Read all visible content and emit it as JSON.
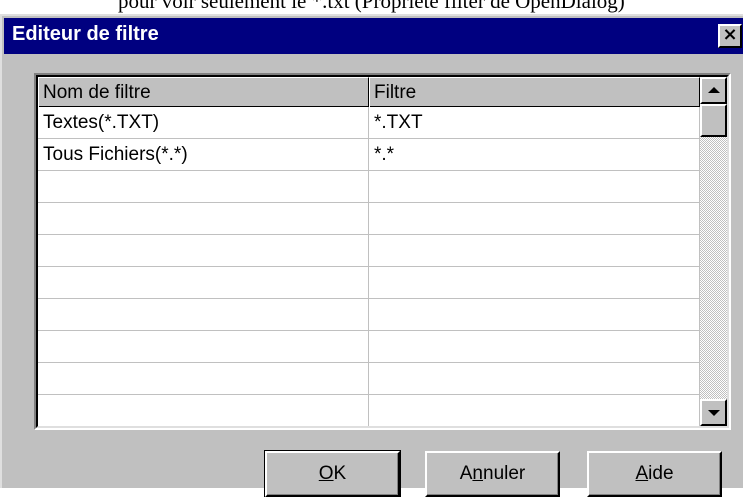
{
  "caption": {
    "text": "pour voir seulement le *.txt  (Propriété filter de OpenDialog)"
  },
  "dialog": {
    "title": "Editeur de filtre",
    "close_glyph": "×"
  },
  "grid": {
    "columns": [
      "Nom de filtre",
      "Filtre"
    ],
    "rows": [
      [
        "Textes(*.TXT)",
        "*.TXT"
      ],
      [
        "Tous Fichiers(*.*)",
        "*.*"
      ],
      [
        "",
        ""
      ],
      [
        "",
        ""
      ],
      [
        "",
        ""
      ],
      [
        "",
        ""
      ],
      [
        "",
        ""
      ],
      [
        "",
        ""
      ],
      [
        "",
        ""
      ],
      [
        "",
        ""
      ]
    ]
  },
  "buttons": {
    "ok": {
      "before": "",
      "mnemonic": "O",
      "after": "K"
    },
    "cancel": {
      "before": "A",
      "mnemonic": "n",
      "after": "nuler"
    },
    "help": {
      "before": "",
      "mnemonic": "A",
      "after": "ide"
    }
  },
  "icons": {
    "close": "close-icon",
    "scroll_up": "arrow-up-icon",
    "scroll_down": "arrow-down-icon"
  },
  "colors": {
    "titlebar": "#000080",
    "face": "#c0c0c0",
    "grid_bg": "#ffffff"
  }
}
